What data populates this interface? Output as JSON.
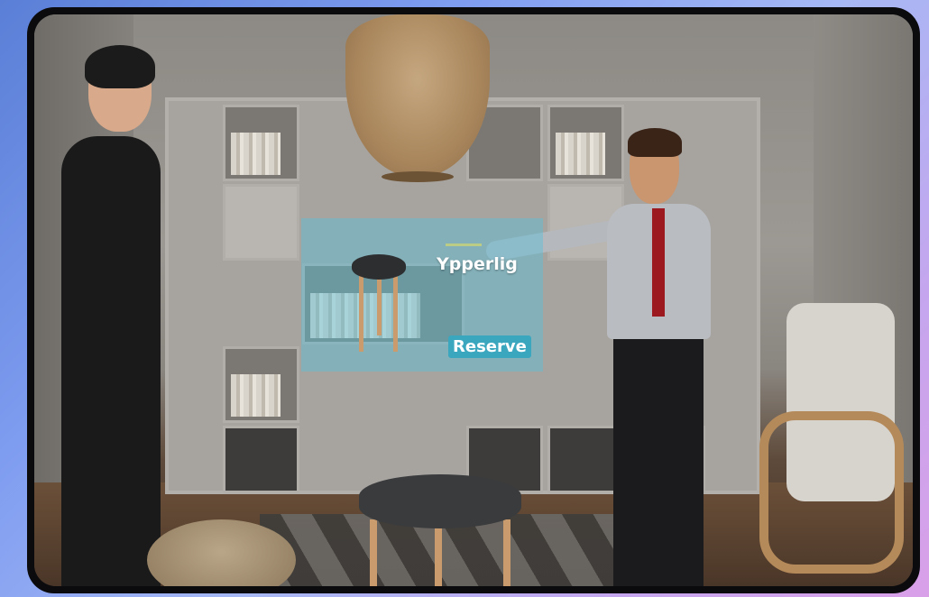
{
  "ar_overlay": {
    "title": "Ypperlig",
    "button_label": "Reserve"
  },
  "colors": {
    "panel_tint": "#5abed7",
    "button_bg": "#3aa7bf",
    "frame": "#0b0b0d"
  },
  "icons": {
    "product_preview": "stool-product-icon"
  }
}
